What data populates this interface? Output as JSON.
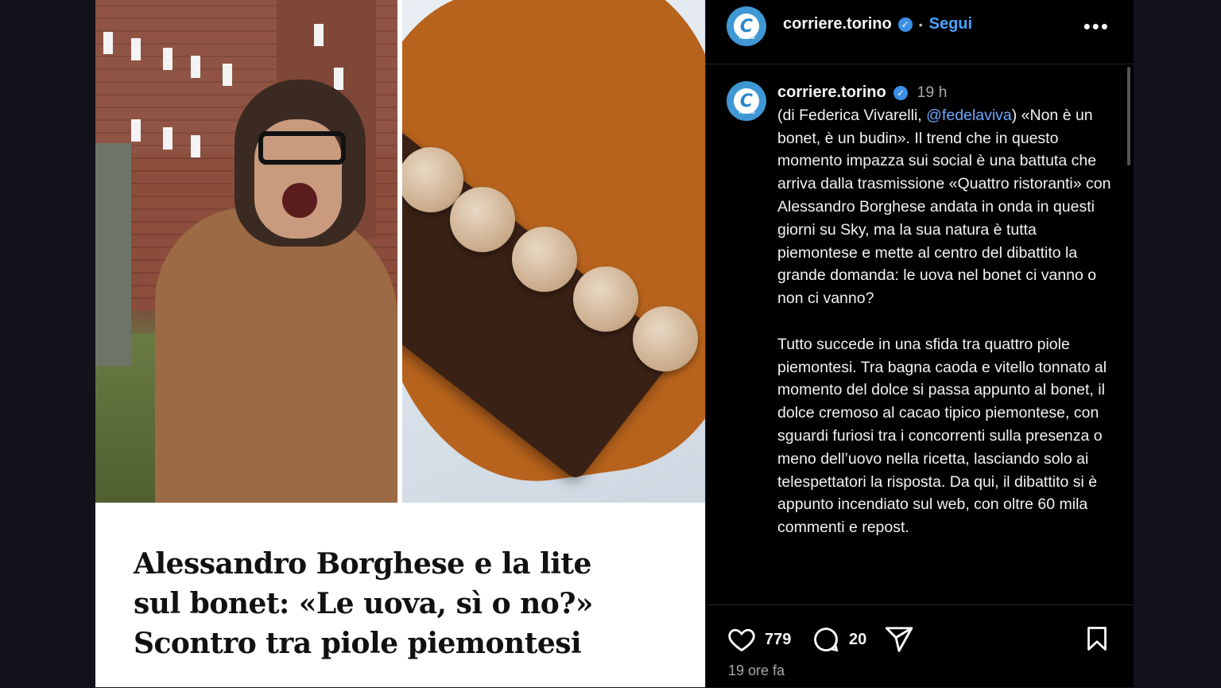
{
  "post": {
    "headline_lines": [
      "Alessandro Borghese e la lite",
      "sul bonet: «Le uova, sì o no?»",
      "Scontro tra piole piemontesi"
    ]
  },
  "header": {
    "username": "corriere.torino",
    "separator": "•",
    "follow_label": "Segui",
    "more_label": "•••",
    "avatar_letter": "C",
    "avatar_sub": "Torino"
  },
  "caption": {
    "username": "corriere.torino",
    "time": "19 h",
    "para1_before": "(di Federica Vivarelli, ",
    "mention": "@fedelaviva",
    "para1_after": ") «Non è un bonet, è un budin». Il trend che in questo momento impazza sui social è una battuta che arriva dalla trasmissione «Quattro ristoranti» con Alessandro Borghese andata in onda in questi giorni su Sky, ma la sua natura è tutta piemontese e mette al centro del dibattito la grande domanda: le uova nel bonet ci vanno o non ci vanno?",
    "para2": "Tutto succede in una sfida tra quattro piole piemontesi. Tra bagna caoda e vitello tonnato al momento del dolce si passa appunto al bonet, il dolce cremoso al cacao tipico piemontese, con sguardi furiosi tra i concorrenti sulla presenza o meno dell’uovo nella ricetta, lasciando solo ai telespettatori la risposta. Da qui, il dibattito si è appunto incendiato sul web, con oltre 60 mila commenti e repost."
  },
  "actions": {
    "likes": "779",
    "comments": "20",
    "time_ago": "19 ore fa"
  },
  "icons": [
    "heart-icon",
    "comment-icon",
    "share-icon",
    "bookmark-icon",
    "verified-icon",
    "more-icon"
  ]
}
